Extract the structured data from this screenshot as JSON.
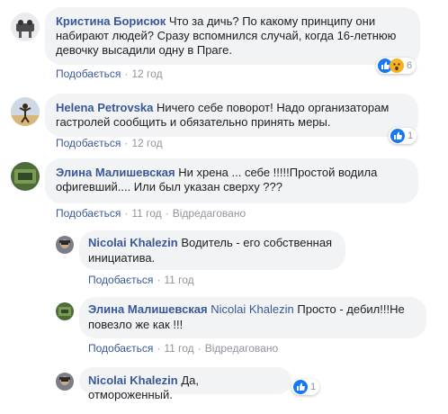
{
  "colors": {
    "link": "#385898",
    "meta": "#90949c",
    "bubble": "#f2f3f5",
    "like_blue": "#1877f2",
    "wow_yellow": "#f7b125"
  },
  "actions": {
    "like": "Подобається",
    "edited": "Відредаговано"
  },
  "comments": [
    {
      "author": "Кристина Борисюк",
      "text": "Что за дичь? По какому принципу они набирают людей? Сразу вспомнился случай, когда 16-летнюю девочку высадили одну в Праге.",
      "time": "12 год",
      "reactions": {
        "icons": [
          "like-icon",
          "wow-icon"
        ],
        "count": "6"
      }
    },
    {
      "author": "Helena Petrovska",
      "text": "Ничего себе поворот! Надо организаторам гастролей сообщить и обязательно принять меры.",
      "time": "12 год",
      "reactions": {
        "icons": [
          "like-icon"
        ],
        "count": "1"
      }
    },
    {
      "author": "Элина Малишевская",
      "text": "Ни хрена ... себе !!!!!Простой водила офигевший.... Или был указан сверху ???",
      "time": "11 год",
      "edited": true
    }
  ],
  "replies": [
    {
      "author": "Nicolai Khalezin",
      "text": "Водитель - его собственная инициатива.",
      "time": "11 год"
    },
    {
      "author": "Элина Малишевская",
      "mention": "Nicolai Khalezin",
      "text": "Просто - дебил!!!Не повезло же как !!!",
      "time": "11 год",
      "edited": true
    },
    {
      "author": "Nicolai Khalezin",
      "mention": "",
      "text": "Да, отмороженный.",
      "time": "11 год",
      "reactions": {
        "icons": [
          "like-icon"
        ],
        "count": "1"
      }
    }
  ]
}
